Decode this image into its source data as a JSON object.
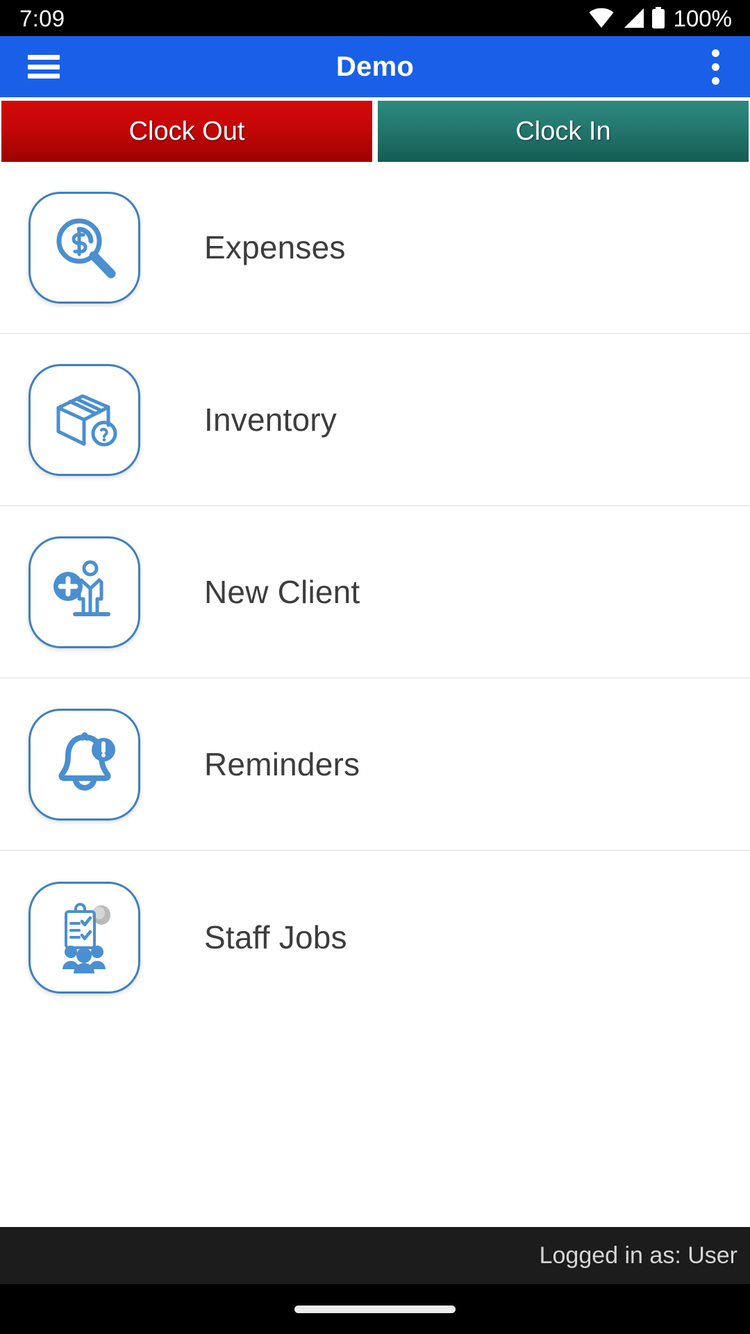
{
  "status_bar": {
    "time": "7:09",
    "battery_percent": "100%",
    "icons": [
      "wifi-icon",
      "cellular-signal-icon",
      "battery-icon"
    ]
  },
  "app_bar": {
    "title": "Demo",
    "menu_icon": "hamburger-menu-icon",
    "overflow_icon": "overflow-menu-icon",
    "background_color": "#1a5fe8"
  },
  "clock_buttons": {
    "clock_out": {
      "label": "Clock Out",
      "color": "#c40707"
    },
    "clock_in": {
      "label": "Clock In",
      "color": "#24776e"
    }
  },
  "menu": {
    "items": [
      {
        "label": "Expenses",
        "icon": "magnifier-dollar-icon"
      },
      {
        "label": "Inventory",
        "icon": "box-question-icon"
      },
      {
        "label": "New Client",
        "icon": "person-plus-icon"
      },
      {
        "label": "Reminders",
        "icon": "bell-alert-icon"
      },
      {
        "label": "Staff Jobs",
        "icon": "clipboard-people-icon"
      }
    ]
  },
  "footer": {
    "logged_in_text": "Logged in as: User"
  },
  "nav_bar": {
    "home_indicator": "home-indicator"
  },
  "theme": {
    "icon_blue": "#4a8fd0",
    "accent_blue": "#1a5fe8",
    "text_gray": "#3d3d3d"
  }
}
